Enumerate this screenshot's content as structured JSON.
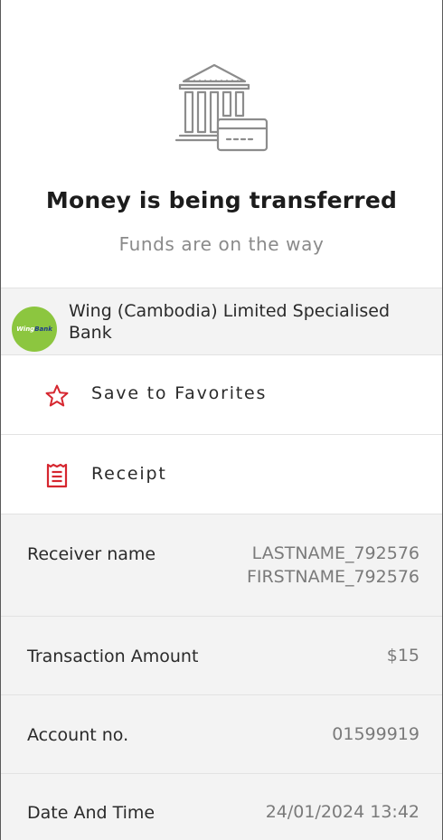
{
  "header": {
    "title": "Money is being transferred",
    "subtitle": "Funds are on the way",
    "icon": "bank-card-icon"
  },
  "bank": {
    "name_line1": "Wing (Cambodia) Limited Specialised",
    "name_line2": "Bank",
    "logo_text_a": "Wing",
    "logo_text_b": "Bank",
    "logo_color": "#8cc63f"
  },
  "actions": {
    "favorites_label": "Save to Favorites",
    "favorites_icon": "star-icon",
    "receipt_label": "Receipt",
    "receipt_icon": "receipt-icon",
    "accent_color": "#d6262f"
  },
  "details": {
    "receiver_label": "Receiver name",
    "receiver_value_line1": "LASTNAME_792576",
    "receiver_value_line2": "FIRSTNAME_792576",
    "amount_label": "Transaction Amount",
    "amount_value": "$15",
    "account_label": "Account no.",
    "account_value": "01599919",
    "datetime_label": "Date And Time",
    "datetime_value": "24/01/2024 13:42"
  }
}
